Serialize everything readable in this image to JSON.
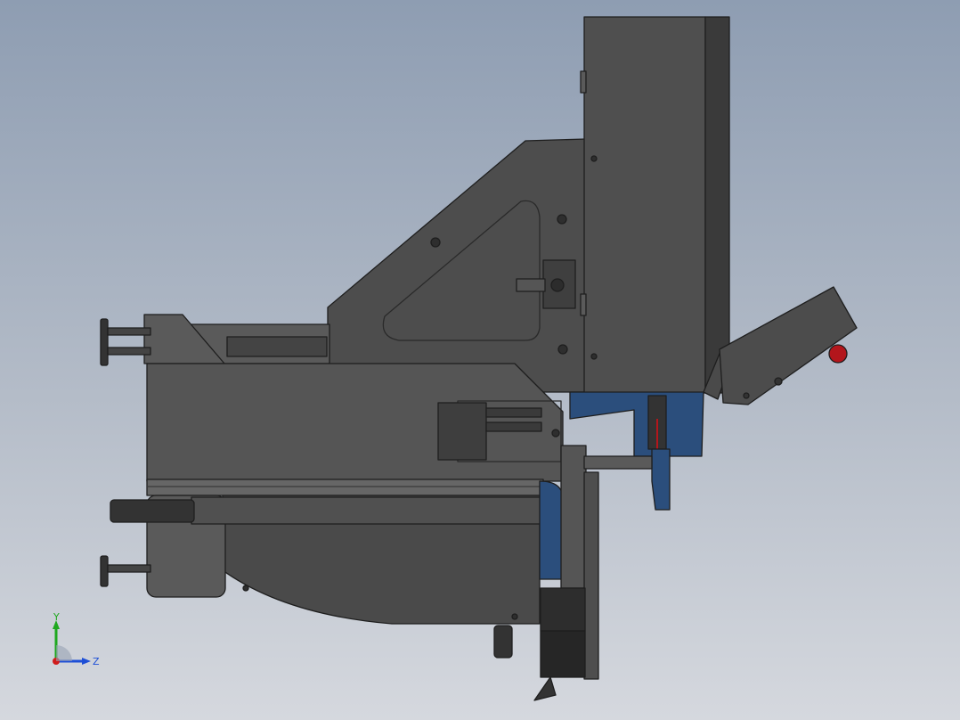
{
  "viewport": {
    "background_top": "#8e9db2",
    "background_bottom": "#d5d8de"
  },
  "model": {
    "body_color": "#4a4a4a",
    "edge_color": "#1e1e1e",
    "accent_blue": "#2b4e7c",
    "emergency_red": "#b3161c"
  },
  "triad": {
    "y_label": "Y",
    "z_label": "Z",
    "y_color": "#1fa81f",
    "z_color": "#1e4fd6",
    "x_color": "#d01c1c"
  }
}
